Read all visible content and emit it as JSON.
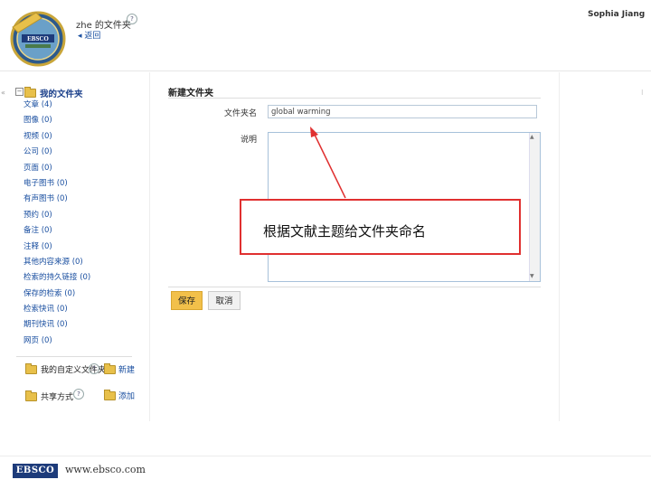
{
  "header": {
    "user_title": "zhe 的文件夹",
    "help_mark": "?",
    "back_link": "◂ 返回",
    "user_name": "Sophia Jiang",
    "logo_text": "EBSCO"
  },
  "sidebar": {
    "collapse_left": "«",
    "collapse_right": "⁝",
    "tree_toggle": "−",
    "my_folder_label": "我的文件夹",
    "categories": [
      "文章 (4)",
      "图像 (0)",
      "视频 (0)",
      "公司 (0)",
      "页面 (0)",
      "电子图书 (0)",
      "有声图书 (0)",
      "预约 (0)",
      "备注 (0)",
      "注释 (0)",
      "其他内容来源 (0)",
      "检索的持久链接 (0)",
      "保存的检索 (0)",
      "检索快讯 (0)",
      "期刊快讯 (0)",
      "网页 (0)"
    ],
    "custom_folders_label": "我的自定义文件夹",
    "new_label": "新建",
    "share_label": "共享方式",
    "add_label": "添加"
  },
  "form": {
    "title": "新建文件夹",
    "name_label": "文件夹名",
    "name_value": "global warming",
    "desc_label": "说明",
    "scroll_up": "▲",
    "scroll_down": "▼",
    "save_label": "保存",
    "cancel_label": "取消"
  },
  "annotation": {
    "text": "根据文献主题给文件夹命名",
    "color": "#e03030"
  },
  "footer": {
    "logo": "EBSCO",
    "url": "www.ebsco.com"
  },
  "colors": {
    "brand": "#1d3b7a",
    "save_button": "#f2c04a",
    "link": "#1a4fa0"
  }
}
